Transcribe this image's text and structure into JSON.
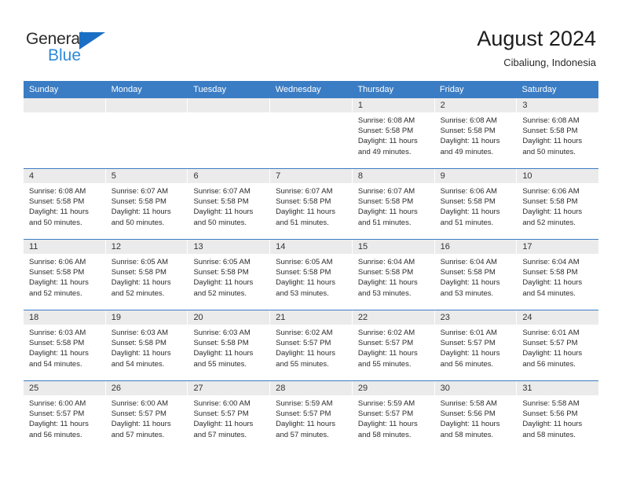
{
  "brand": {
    "name_top": "General",
    "name_bottom": "Blue",
    "accent_color": "#2e8ad8",
    "triangle_color": "#1a6fc4"
  },
  "header": {
    "title": "August 2024",
    "subtitle": "Cibaliung, Indonesia",
    "header_bg": "#3b7dc4",
    "daynum_bg": "#ebebeb"
  },
  "weekdays": [
    "Sunday",
    "Monday",
    "Tuesday",
    "Wednesday",
    "Thursday",
    "Friday",
    "Saturday"
  ],
  "weeks": [
    [
      {
        "num": "",
        "empty": true
      },
      {
        "num": "",
        "empty": true
      },
      {
        "num": "",
        "empty": true
      },
      {
        "num": "",
        "empty": true
      },
      {
        "num": "1",
        "sunrise": "Sunrise: 6:08 AM",
        "sunset": "Sunset: 5:58 PM",
        "daylight_1": "Daylight: 11 hours",
        "daylight_2": "and 49 minutes."
      },
      {
        "num": "2",
        "sunrise": "Sunrise: 6:08 AM",
        "sunset": "Sunset: 5:58 PM",
        "daylight_1": "Daylight: 11 hours",
        "daylight_2": "and 49 minutes."
      },
      {
        "num": "3",
        "sunrise": "Sunrise: 6:08 AM",
        "sunset": "Sunset: 5:58 PM",
        "daylight_1": "Daylight: 11 hours",
        "daylight_2": "and 50 minutes."
      }
    ],
    [
      {
        "num": "4",
        "sunrise": "Sunrise: 6:08 AM",
        "sunset": "Sunset: 5:58 PM",
        "daylight_1": "Daylight: 11 hours",
        "daylight_2": "and 50 minutes."
      },
      {
        "num": "5",
        "sunrise": "Sunrise: 6:07 AM",
        "sunset": "Sunset: 5:58 PM",
        "daylight_1": "Daylight: 11 hours",
        "daylight_2": "and 50 minutes."
      },
      {
        "num": "6",
        "sunrise": "Sunrise: 6:07 AM",
        "sunset": "Sunset: 5:58 PM",
        "daylight_1": "Daylight: 11 hours",
        "daylight_2": "and 50 minutes."
      },
      {
        "num": "7",
        "sunrise": "Sunrise: 6:07 AM",
        "sunset": "Sunset: 5:58 PM",
        "daylight_1": "Daylight: 11 hours",
        "daylight_2": "and 51 minutes."
      },
      {
        "num": "8",
        "sunrise": "Sunrise: 6:07 AM",
        "sunset": "Sunset: 5:58 PM",
        "daylight_1": "Daylight: 11 hours",
        "daylight_2": "and 51 minutes."
      },
      {
        "num": "9",
        "sunrise": "Sunrise: 6:06 AM",
        "sunset": "Sunset: 5:58 PM",
        "daylight_1": "Daylight: 11 hours",
        "daylight_2": "and 51 minutes."
      },
      {
        "num": "10",
        "sunrise": "Sunrise: 6:06 AM",
        "sunset": "Sunset: 5:58 PM",
        "daylight_1": "Daylight: 11 hours",
        "daylight_2": "and 52 minutes."
      }
    ],
    [
      {
        "num": "11",
        "sunrise": "Sunrise: 6:06 AM",
        "sunset": "Sunset: 5:58 PM",
        "daylight_1": "Daylight: 11 hours",
        "daylight_2": "and 52 minutes."
      },
      {
        "num": "12",
        "sunrise": "Sunrise: 6:05 AM",
        "sunset": "Sunset: 5:58 PM",
        "daylight_1": "Daylight: 11 hours",
        "daylight_2": "and 52 minutes."
      },
      {
        "num": "13",
        "sunrise": "Sunrise: 6:05 AM",
        "sunset": "Sunset: 5:58 PM",
        "daylight_1": "Daylight: 11 hours",
        "daylight_2": "and 52 minutes."
      },
      {
        "num": "14",
        "sunrise": "Sunrise: 6:05 AM",
        "sunset": "Sunset: 5:58 PM",
        "daylight_1": "Daylight: 11 hours",
        "daylight_2": "and 53 minutes."
      },
      {
        "num": "15",
        "sunrise": "Sunrise: 6:04 AM",
        "sunset": "Sunset: 5:58 PM",
        "daylight_1": "Daylight: 11 hours",
        "daylight_2": "and 53 minutes."
      },
      {
        "num": "16",
        "sunrise": "Sunrise: 6:04 AM",
        "sunset": "Sunset: 5:58 PM",
        "daylight_1": "Daylight: 11 hours",
        "daylight_2": "and 53 minutes."
      },
      {
        "num": "17",
        "sunrise": "Sunrise: 6:04 AM",
        "sunset": "Sunset: 5:58 PM",
        "daylight_1": "Daylight: 11 hours",
        "daylight_2": "and 54 minutes."
      }
    ],
    [
      {
        "num": "18",
        "sunrise": "Sunrise: 6:03 AM",
        "sunset": "Sunset: 5:58 PM",
        "daylight_1": "Daylight: 11 hours",
        "daylight_2": "and 54 minutes."
      },
      {
        "num": "19",
        "sunrise": "Sunrise: 6:03 AM",
        "sunset": "Sunset: 5:58 PM",
        "daylight_1": "Daylight: 11 hours",
        "daylight_2": "and 54 minutes."
      },
      {
        "num": "20",
        "sunrise": "Sunrise: 6:03 AM",
        "sunset": "Sunset: 5:58 PM",
        "daylight_1": "Daylight: 11 hours",
        "daylight_2": "and 55 minutes."
      },
      {
        "num": "21",
        "sunrise": "Sunrise: 6:02 AM",
        "sunset": "Sunset: 5:57 PM",
        "daylight_1": "Daylight: 11 hours",
        "daylight_2": "and 55 minutes."
      },
      {
        "num": "22",
        "sunrise": "Sunrise: 6:02 AM",
        "sunset": "Sunset: 5:57 PM",
        "daylight_1": "Daylight: 11 hours",
        "daylight_2": "and 55 minutes."
      },
      {
        "num": "23",
        "sunrise": "Sunrise: 6:01 AM",
        "sunset": "Sunset: 5:57 PM",
        "daylight_1": "Daylight: 11 hours",
        "daylight_2": "and 56 minutes."
      },
      {
        "num": "24",
        "sunrise": "Sunrise: 6:01 AM",
        "sunset": "Sunset: 5:57 PM",
        "daylight_1": "Daylight: 11 hours",
        "daylight_2": "and 56 minutes."
      }
    ],
    [
      {
        "num": "25",
        "sunrise": "Sunrise: 6:00 AM",
        "sunset": "Sunset: 5:57 PM",
        "daylight_1": "Daylight: 11 hours",
        "daylight_2": "and 56 minutes."
      },
      {
        "num": "26",
        "sunrise": "Sunrise: 6:00 AM",
        "sunset": "Sunset: 5:57 PM",
        "daylight_1": "Daylight: 11 hours",
        "daylight_2": "and 57 minutes."
      },
      {
        "num": "27",
        "sunrise": "Sunrise: 6:00 AM",
        "sunset": "Sunset: 5:57 PM",
        "daylight_1": "Daylight: 11 hours",
        "daylight_2": "and 57 minutes."
      },
      {
        "num": "28",
        "sunrise": "Sunrise: 5:59 AM",
        "sunset": "Sunset: 5:57 PM",
        "daylight_1": "Daylight: 11 hours",
        "daylight_2": "and 57 minutes."
      },
      {
        "num": "29",
        "sunrise": "Sunrise: 5:59 AM",
        "sunset": "Sunset: 5:57 PM",
        "daylight_1": "Daylight: 11 hours",
        "daylight_2": "and 58 minutes."
      },
      {
        "num": "30",
        "sunrise": "Sunrise: 5:58 AM",
        "sunset": "Sunset: 5:56 PM",
        "daylight_1": "Daylight: 11 hours",
        "daylight_2": "and 58 minutes."
      },
      {
        "num": "31",
        "sunrise": "Sunrise: 5:58 AM",
        "sunset": "Sunset: 5:56 PM",
        "daylight_1": "Daylight: 11 hours",
        "daylight_2": "and 58 minutes."
      }
    ]
  ]
}
